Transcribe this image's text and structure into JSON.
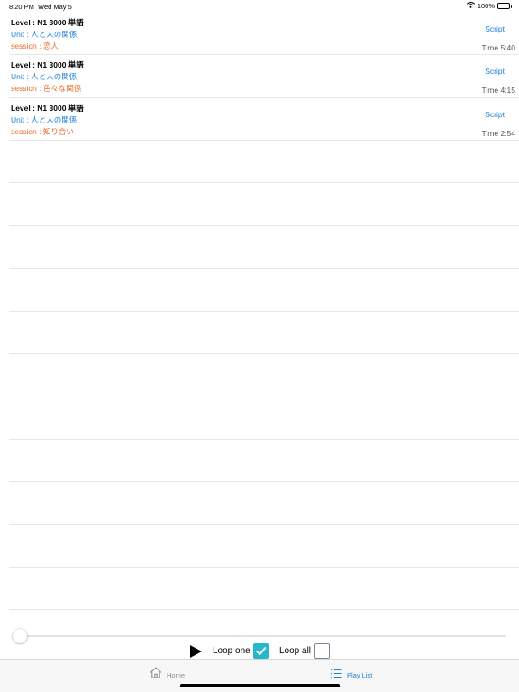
{
  "status_bar": {
    "time": "8:20 PM",
    "date": "Wed May 5",
    "battery_text": "100%",
    "battery_level": 1.0
  },
  "playlist": [
    {
      "level": "Level : N1 3000 単語",
      "unit": "Unit : 人と人の関係",
      "session": "session : 恋人",
      "script_label": "Script",
      "time": "Time 5:40"
    },
    {
      "level": "Level : N1 3000 単語",
      "unit": "Unit : 人と人の関係",
      "session": "session : 色々な関係",
      "script_label": "Script",
      "time": "Time 4:15"
    },
    {
      "level": "Level : N1 3000 単語",
      "unit": "Unit : 人と人の関係",
      "session": "session : 知り合い",
      "script_label": "Script",
      "time": "Time 2:54"
    }
  ],
  "player": {
    "progress": 0,
    "loop_one_label": "Loop one",
    "loop_one_checked": true,
    "loop_all_label": "Loop all",
    "loop_all_checked": false
  },
  "tab_bar": {
    "home_label": "Home",
    "playlist_label": "Play List",
    "selected": "Play List"
  },
  "colors": {
    "accent": "#1d7fd6",
    "session": "#ea6a2a",
    "checkbox": "#26b7c9"
  }
}
